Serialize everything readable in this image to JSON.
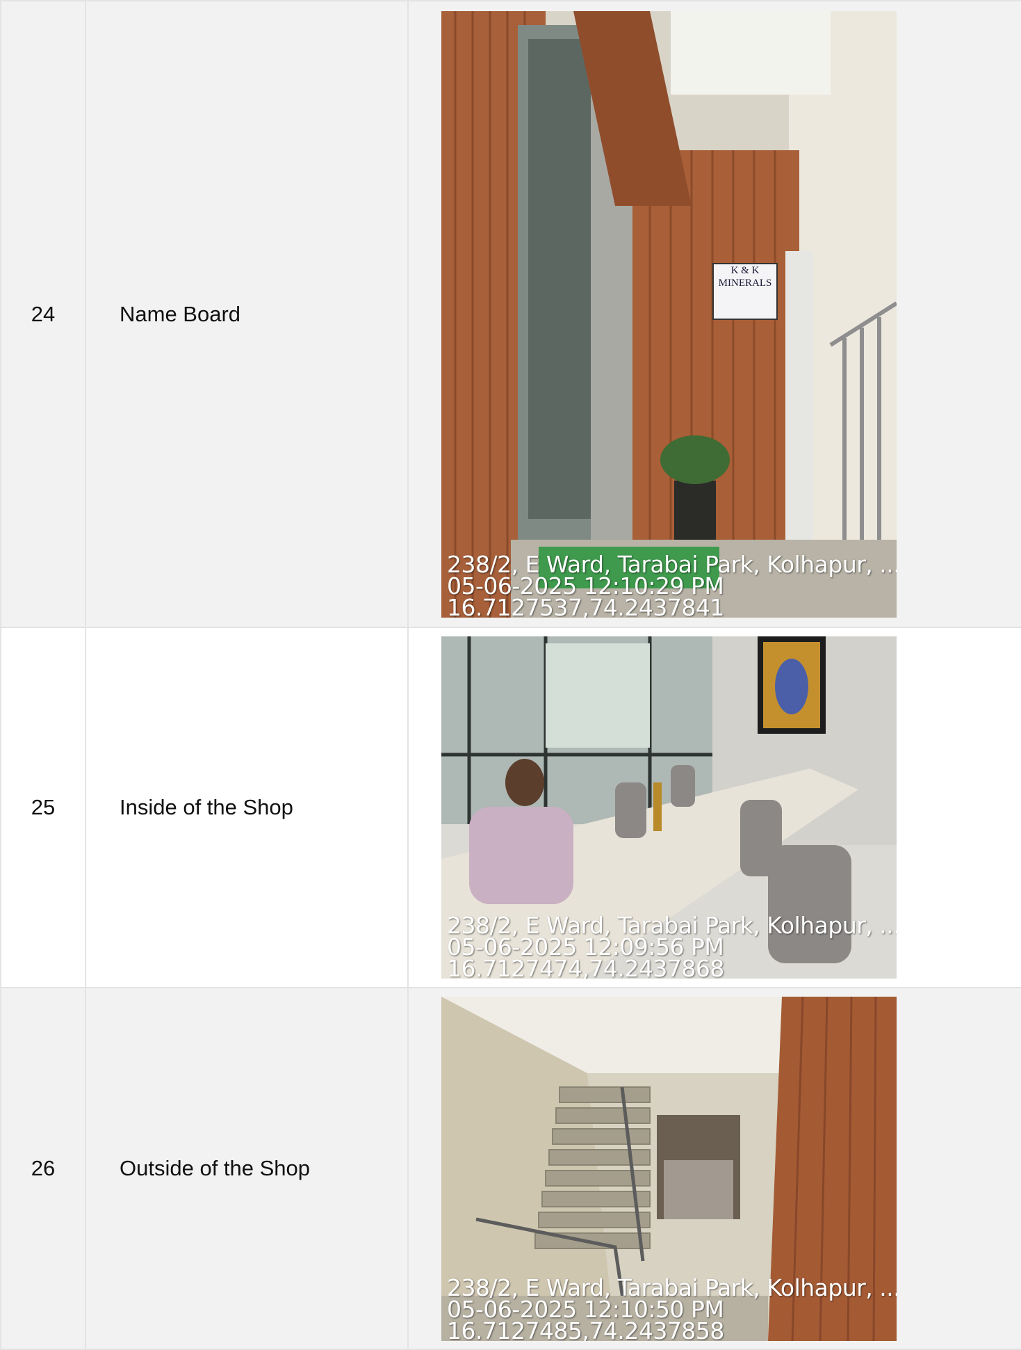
{
  "rows": [
    {
      "number": "24",
      "label": "Name Board",
      "photo": {
        "name_board_text": "K & K MINERALS",
        "address": "238/2, E Ward, Tarabai Park, Kolhapur, ...",
        "datetime": "05-06-2025 12:10:29 PM",
        "coords": "16.7127537,74.2437841"
      }
    },
    {
      "number": "25",
      "label": "Inside of the Shop",
      "photo": {
        "address": "238/2, E Ward, Tarabai Park, Kolhapur, ...",
        "datetime": "05-06-2025 12:09:56 PM",
        "coords": "16.7127474,74.2437868"
      }
    },
    {
      "number": "26",
      "label": "Outside of the Shop",
      "photo": {
        "address": "238/2, E Ward, Tarabai Park, Kolhapur, ...",
        "datetime": "05-06-2025 12:10:50 PM",
        "coords": "16.7127485,74.2437858"
      }
    }
  ]
}
